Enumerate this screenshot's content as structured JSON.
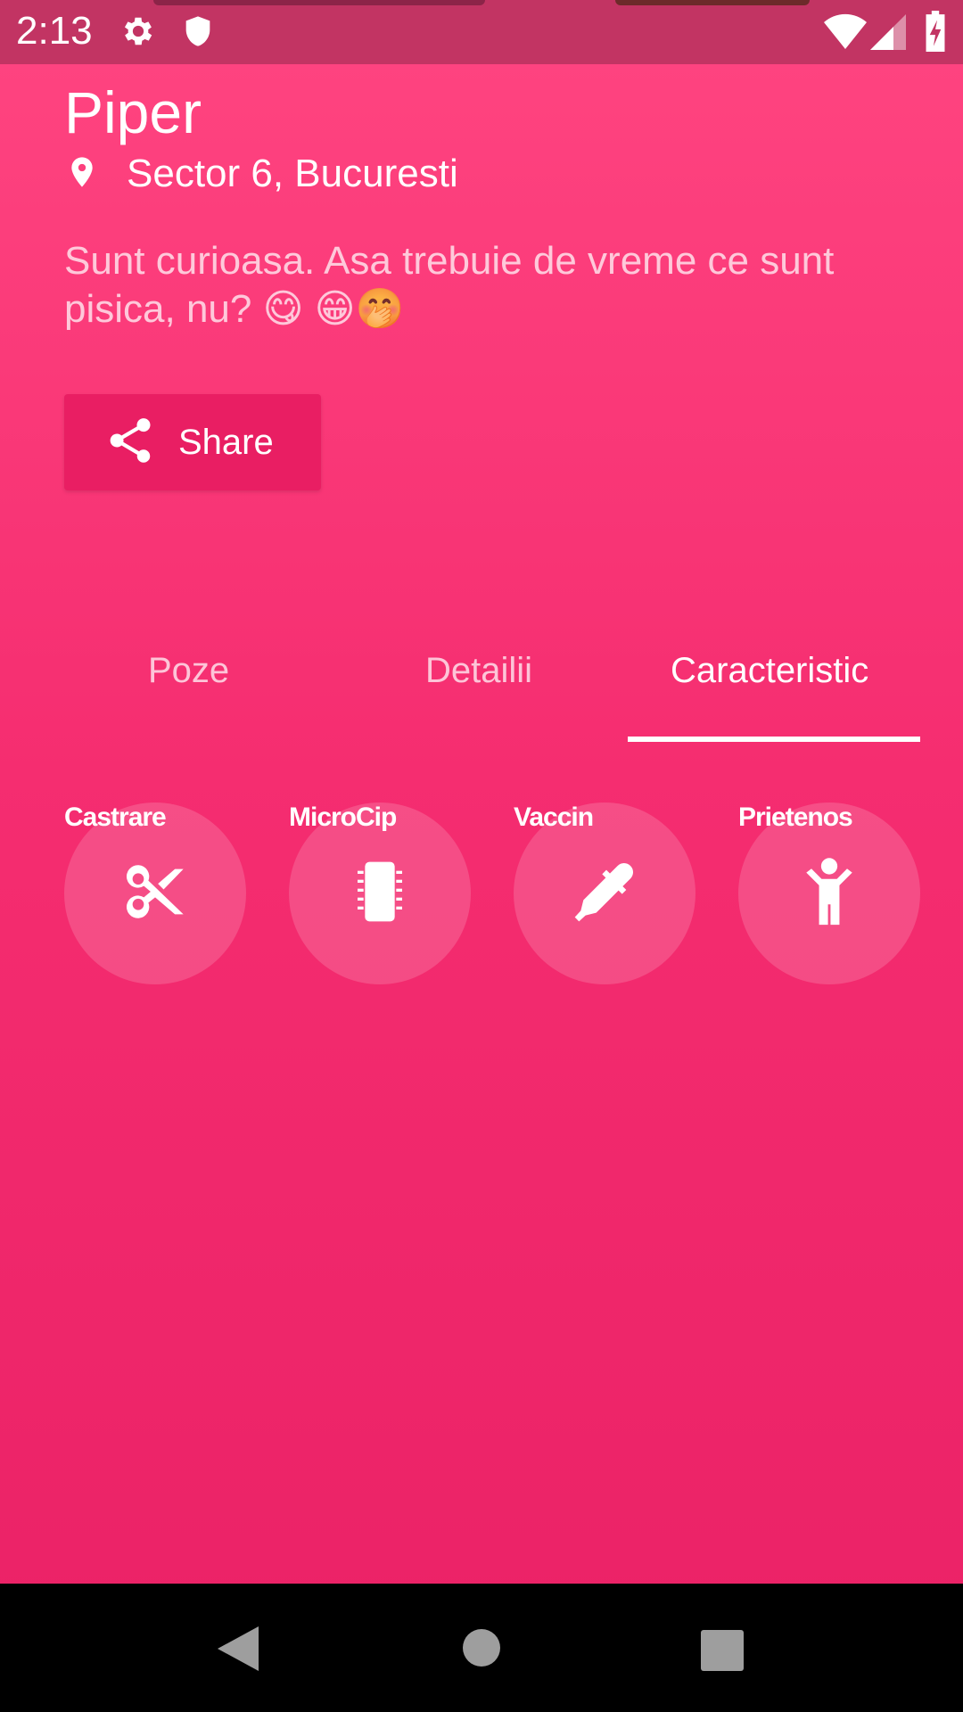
{
  "status_bar": {
    "time": "2:13",
    "icons": [
      "gear-icon",
      "shield-icon",
      "wifi-icon",
      "signal-icon",
      "battery-charging-icon"
    ]
  },
  "profile": {
    "name": "Piper",
    "location": "Sector 6, Bucuresti",
    "description": "Sunt curioasa. Asa trebuie de vreme ce sunt pisica, nu? 😋 😁🤭"
  },
  "share": {
    "label": "Share",
    "icon": "share-icon"
  },
  "tabs": [
    {
      "label": "Poze"
    },
    {
      "label": "Detailii"
    },
    {
      "label": "Caracteristic"
    }
  ],
  "active_tab": "Caracteristic",
  "features": [
    {
      "label": "Castrare",
      "icon": "scissors-icon"
    },
    {
      "label": "MicroCip",
      "icon": "microchip-icon"
    },
    {
      "label": "Vaccin",
      "icon": "dropper-icon"
    },
    {
      "label": "Prietenos",
      "icon": "person-icon"
    }
  ],
  "nav": [
    "back-icon",
    "home-icon",
    "recents-icon"
  ],
  "colors": {
    "background": "#f52d70",
    "status_bar": "#c23463",
    "share_button": "#e91e63",
    "nav_bar": "#000000"
  }
}
